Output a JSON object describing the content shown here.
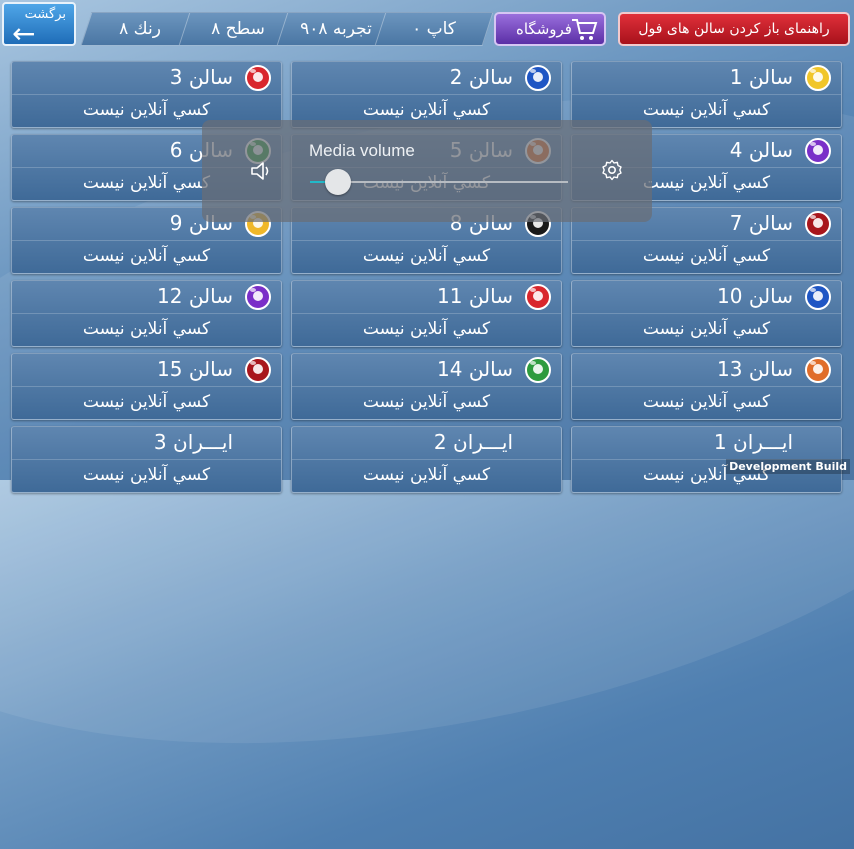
{
  "header": {
    "back_label": "برگشت",
    "stats": [
      "رنك ٨",
      "سطح ٨",
      "تجربه ٩٠٨",
      "كاپ ٠"
    ],
    "shop_label": "فروشگاه",
    "guide_label": "راهنمای باز کردن سالن های فول"
  },
  "rooms": [
    {
      "name": "سالن 1",
      "status": "كسي آنلاين نيست",
      "ball_color": "#f1c62a"
    },
    {
      "name": "سالن 2",
      "status": "كسي آنلاين نيست",
      "ball_color": "#1f56c4"
    },
    {
      "name": "سالن 3",
      "status": "كسي آنلاين نيست",
      "ball_color": "#d9262d"
    },
    {
      "name": "سالن 4",
      "status": "كسي آنلاين نيست",
      "ball_color": "#7a2fc8"
    },
    {
      "name": "سالن 5",
      "status": "كسي آنلاين نيست",
      "ball_color": "#e06d2a"
    },
    {
      "name": "سالن 6",
      "status": "كسي آنلاين نيست",
      "ball_color": "#2e9b3e"
    },
    {
      "name": "سالن 7",
      "status": "كسي آنلاين نيست",
      "ball_color": "#a8161c"
    },
    {
      "name": "سالن 8",
      "status": "كسي آنلاين نيست",
      "ball_color": "#1a1a1a"
    },
    {
      "name": "سالن 9",
      "status": "كسي آنلاين نيست",
      "ball_color": "#f0b82a"
    },
    {
      "name": "سالن 10",
      "status": "كسي آنلاين نيست",
      "ball_color": "#1f56c4"
    },
    {
      "name": "سالن 11",
      "status": "كسي آنلاين نيست",
      "ball_color": "#d9262d"
    },
    {
      "name": "سالن 12",
      "status": "كسي آنلاين نيست",
      "ball_color": "#7a2fc8"
    },
    {
      "name": "سالن 13",
      "status": "كسي آنلاين نيست",
      "ball_color": "#e06d2a"
    },
    {
      "name": "سالن 14",
      "status": "كسي آنلاين نيست",
      "ball_color": "#2e9b3e"
    },
    {
      "name": "سالن 15",
      "status": "كسي آنلاين نيست",
      "ball_color": "#a8161c"
    },
    {
      "name": "ايـــران 1",
      "status": "كسي آنلاين نيست",
      "ball_color": ""
    },
    {
      "name": "ايـــران 2",
      "status": "كسي آنلاين نيست",
      "ball_color": ""
    },
    {
      "name": "ايـــران 3",
      "status": "كسي آنلاين نيست",
      "ball_color": ""
    }
  ],
  "volume_dialog": {
    "title": "Media volume",
    "level_fraction": 0.11,
    "speaker_icon": "speaker-icon",
    "settings_icon": "gear-icon"
  },
  "dev_build_label": "Development Build",
  "colors": {
    "back_button": "#2a82d0",
    "shop_button": "#6f3cc0",
    "guide_button": "#c91c26",
    "volume_accent": "#22b9c8"
  }
}
